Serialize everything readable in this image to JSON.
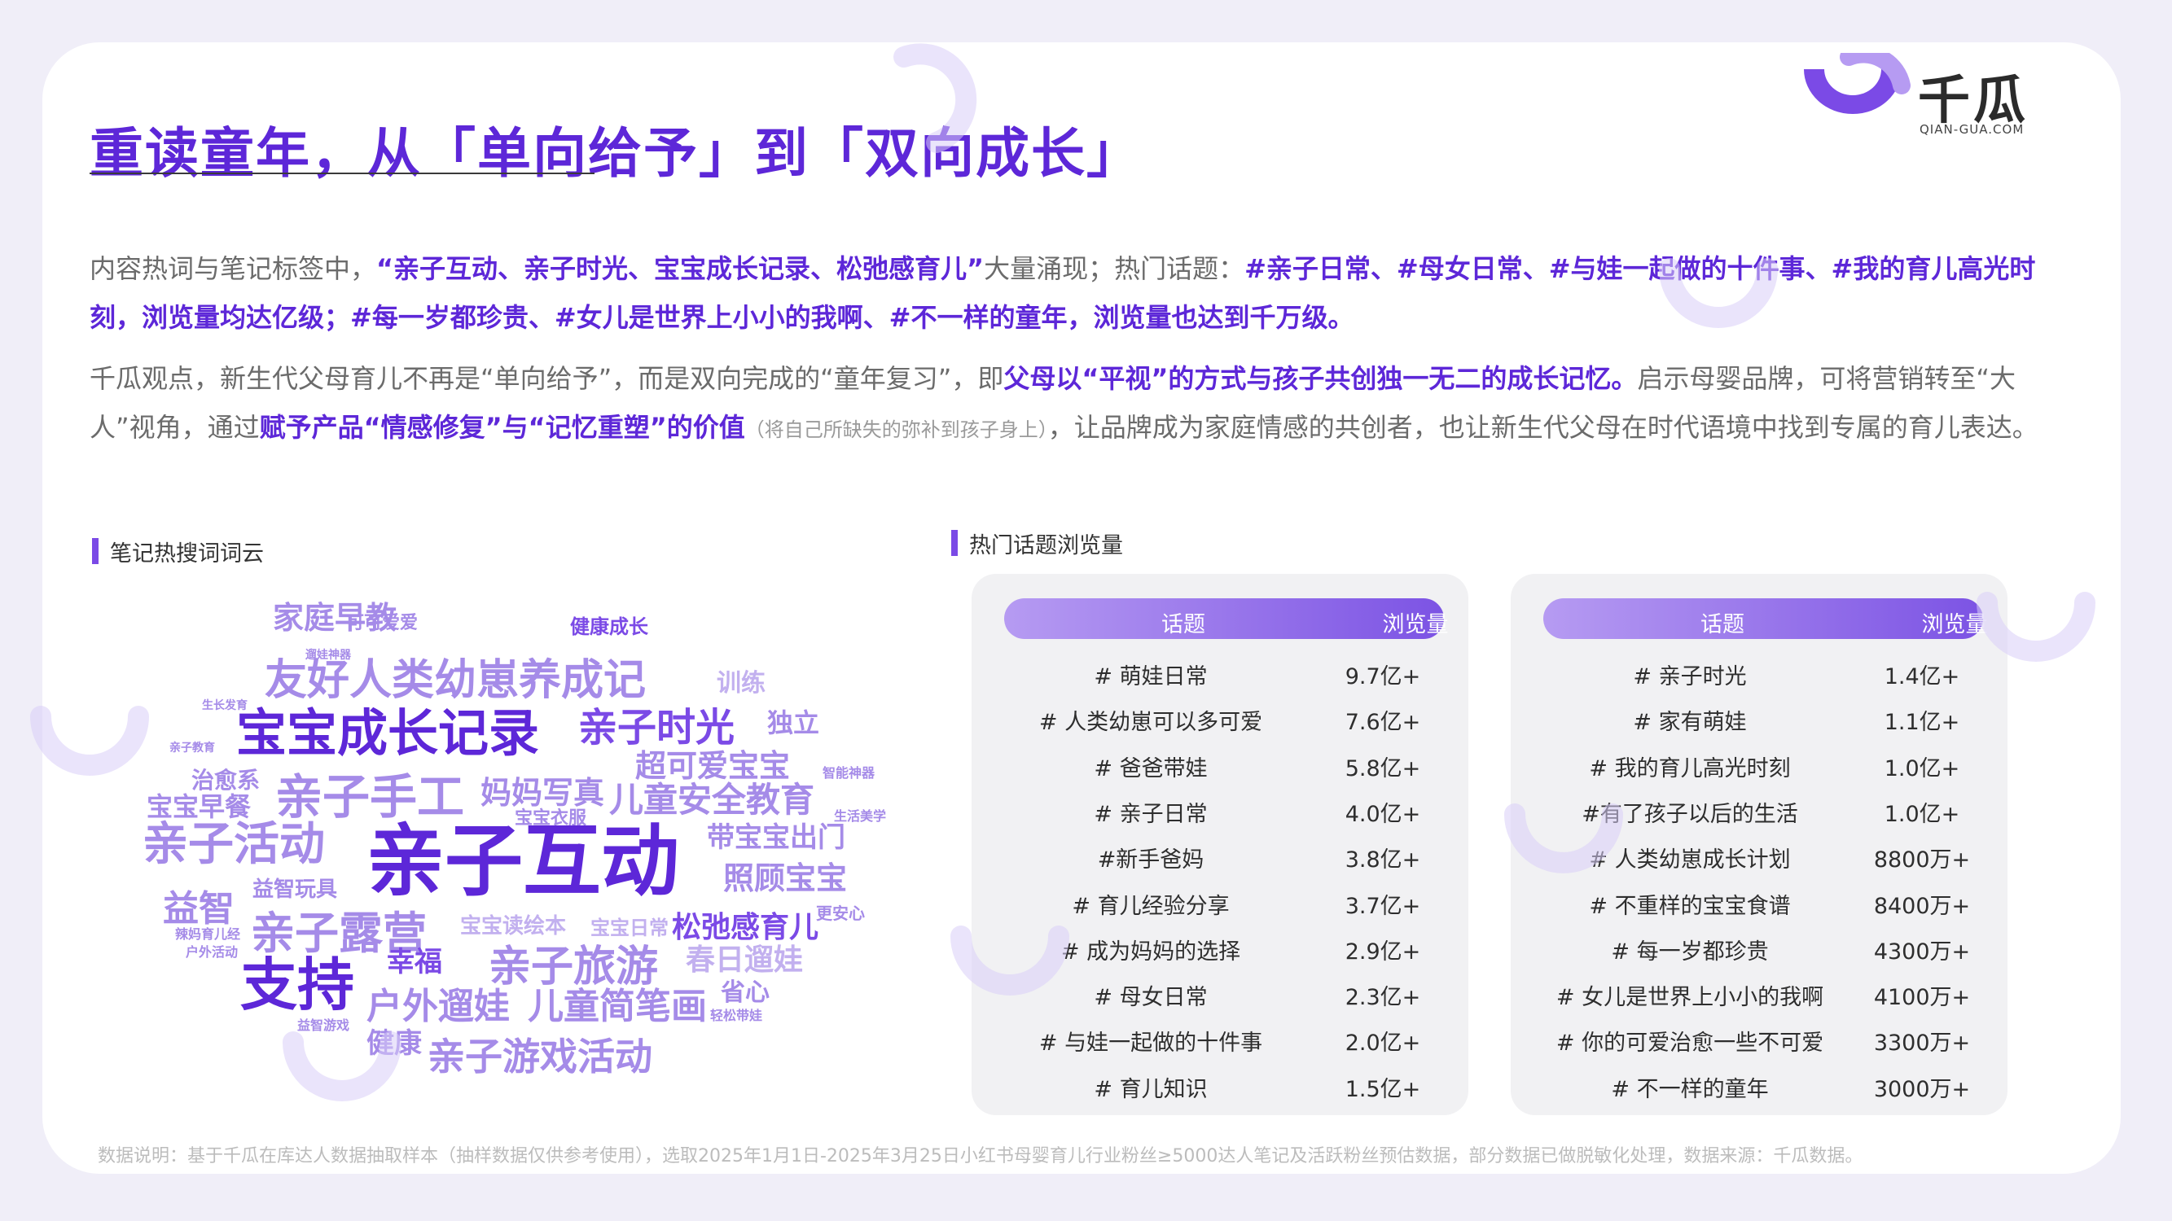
{
  "header": {
    "title": "重读童年，从「单向给予」到「双向成长」",
    "logo_text": "千瓜",
    "logo_sub": "QIAN-GUA.COM"
  },
  "para1": [
    {
      "t": "内容热词与笔记标签中，",
      "hl": false
    },
    {
      "t": "“亲子互动、亲子时光、宝宝成长记录、松弛感育儿”",
      "hl": true
    },
    {
      "t": "大量涌现；热门话题：",
      "hl": false
    },
    {
      "t": "#亲子日常、#母女日常、#与娃一起做的十件事、#我的育儿高光时刻，浏览量均达亿级；#每一岁都珍贵、#女儿是世界上小小的我啊、#不一样的童年，浏览量也达到千万级。",
      "hl": true
    }
  ],
  "para2": [
    {
      "t": "千瓜观点，新生代父母育儿不再是“单向给予”，而是双向完成的“童年复习”，即",
      "hl": false
    },
    {
      "t": "父母以“平视”的方式与孩子共创独一无二的成长记忆。",
      "hl": true
    },
    {
      "t": "启示母婴品牌，可将营销转至“大人”视角，通过",
      "hl": false
    },
    {
      "t": "赋予产品“情感修复”与“记忆重塑”的价值",
      "hl": true
    },
    {
      "t": "（将自己所缺失的弥补到孩子身上）",
      "hl": false,
      "small": true
    },
    {
      "t": "，让品牌成为家庭情感的共创者，也让新生代父母在时代语境中找到专属的育儿表达。",
      "hl": false
    }
  ],
  "wordcloud": {
    "label": "笔记热搜词词云",
    "words": [
      "家庭早教",
      "可可爱爱",
      "健康成长",
      "遛娃神器",
      "友好人类幼崽养成记",
      "训练",
      "生长发育",
      "宝宝成长记录",
      "亲子时光",
      "独立",
      "亲子教育",
      "超可爱宝宝",
      "治愈系",
      "智能神器",
      "宝宝早餐",
      "亲子手工",
      "妈妈写真",
      "儿童安全教育",
      "宝宝衣服",
      "生活美学",
      "亲子活动",
      "带宝宝出门",
      "亲子互动",
      "照顾宝宝",
      "益智玩具",
      "益智",
      "亲子露营",
      "宝宝读绘本",
      "宝宝日常",
      "松弛感育儿",
      "更安心",
      "辣妈育儿经",
      "户外活动",
      "幸福",
      "亲子旅游",
      "春日遛娃",
      "支持",
      "户外遛娃",
      "儿童简笔画",
      "省心",
      "益智游戏",
      "轻松带娃",
      "健康",
      "亲子游戏活动"
    ]
  },
  "tables": {
    "label": "热门话题浏览量",
    "headers": [
      "话题",
      "浏览量"
    ],
    "left": [
      [
        "# 萌娃日常",
        "9.7亿+"
      ],
      [
        "# 人类幼崽可以多可爱",
        "7.6亿+"
      ],
      [
        "# 爸爸带娃",
        "5.8亿+"
      ],
      [
        "# 亲子日常",
        "4.0亿+"
      ],
      [
        "#新手爸妈",
        "3.8亿+"
      ],
      [
        "# 育儿经验分享",
        "3.7亿+"
      ],
      [
        "# 成为妈妈的选择",
        "2.9亿+"
      ],
      [
        "# 母女日常",
        "2.3亿+"
      ],
      [
        "# 与娃一起做的十件事",
        "2.0亿+"
      ],
      [
        "# 育儿知识",
        "1.5亿+"
      ]
    ],
    "right": [
      [
        "# 亲子时光",
        "1.4亿+"
      ],
      [
        "# 家有萌娃",
        "1.1亿+"
      ],
      [
        "# 我的育儿高光时刻",
        "1.0亿+"
      ],
      [
        "#有了孩子以后的生活",
        "1.0亿+"
      ],
      [
        "# 人类幼崽成长计划",
        "8800万+"
      ],
      [
        "# 不重样的宝宝食谱",
        "8400万+"
      ],
      [
        "# 每一岁都珍贵",
        "4300万+"
      ],
      [
        "# 女儿是世界上小小的我啊",
        "4100万+"
      ],
      [
        "# 你的可爱治愈一些不可爱",
        "3300万+"
      ],
      [
        "# 不一样的童年",
        "3000万+"
      ]
    ]
  },
  "footnote": "数据说明：基于千瓜在库达人数据抽取样本（抽样数据仅供参考使用），选取2025年1月1日-2025年3月25日小红书母婴育儿行业粉丝≥5000达人笔记及活跃粉丝预估数据，部分数据已做脱敏化处理，数据来源：千瓜数据。",
  "colors": {
    "accent": "#5d27d8",
    "light_purple": "#a58be8",
    "text": "#6b6b6b"
  }
}
